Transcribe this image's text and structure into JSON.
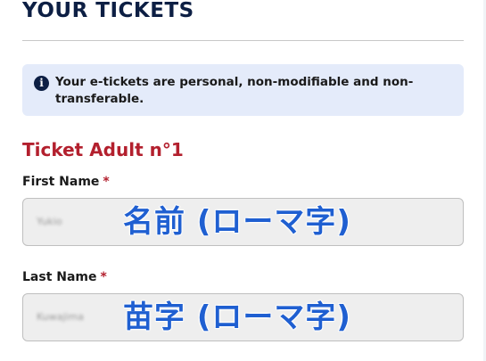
{
  "section": {
    "title": "YOUR TICKETS"
  },
  "notice": {
    "icon": "info-icon",
    "icon_glyph": "i",
    "text": "Your e-tickets are personal, non-modifiable and non-transferable."
  },
  "ticket": {
    "heading": "Ticket Adult n°1",
    "first_name": {
      "label": "First Name",
      "required_mark": "*",
      "value": "Yukio",
      "overlay": "名前 (ローマ字)"
    },
    "last_name": {
      "label": "Last Name",
      "required_mark": "*",
      "value": "Kuwajima",
      "overlay": "苗字 (ローマ字)"
    }
  },
  "colors": {
    "title": "#0d1f44",
    "accent_red": "#b3202e",
    "notice_bg": "#e4ebfa",
    "overlay_blue": "#1f5fd1",
    "field_bg": "#eeeeee"
  }
}
